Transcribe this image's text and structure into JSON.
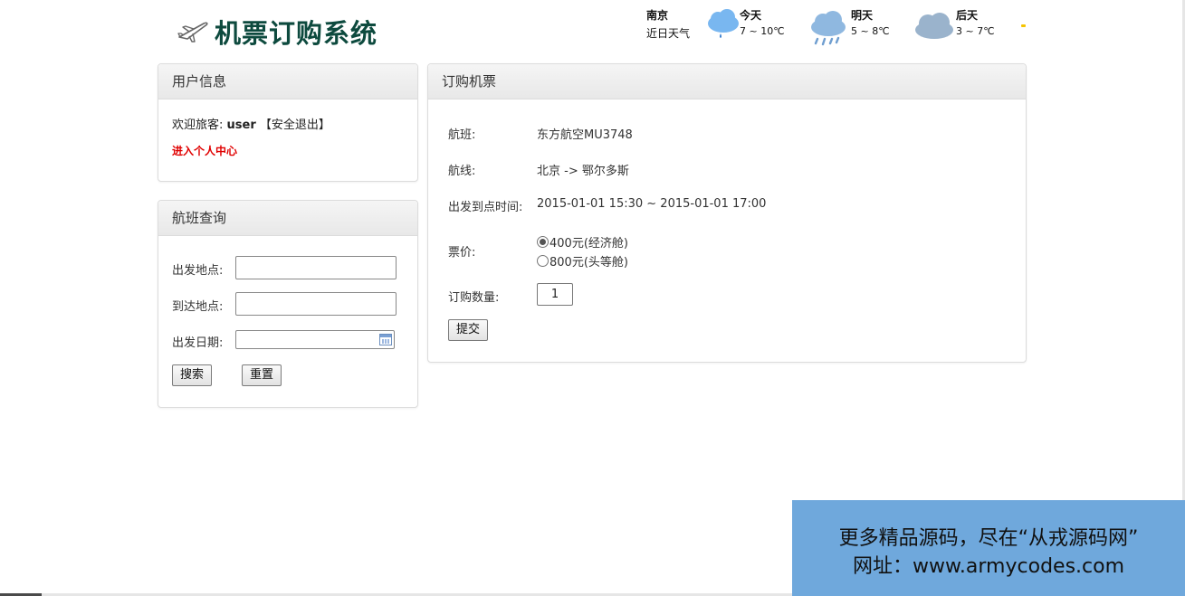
{
  "header": {
    "title": "机票订购系统",
    "logo_icon": "airplane-icon"
  },
  "weather": {
    "city": "南京",
    "subtitle": "近日天气",
    "days": [
      {
        "name": "今天",
        "temp": "7 ~ 10℃",
        "icon": "light-rain-icon",
        "color": "#79b7f0"
      },
      {
        "name": "明天",
        "temp": "5 ~ 8℃",
        "icon": "rain-icon",
        "color": "#8fb8e0"
      },
      {
        "name": "后天",
        "temp": "3 ~ 7℃",
        "icon": "cloudy-icon",
        "color": "#9ab3cc"
      }
    ]
  },
  "user_panel": {
    "title": "用户信息",
    "welcome_prefix": "欢迎旅客:",
    "username": "user",
    "logout_label": "【安全退出】",
    "center_link": "进入个人中心",
    "link_color": "#e00000"
  },
  "search_panel": {
    "title": "航班查询",
    "depart_label": "出发地点:",
    "depart_value": "",
    "arrive_label": "到达地点:",
    "arrive_value": "",
    "date_label": "出发日期:",
    "date_value": "",
    "search_button": "搜索",
    "reset_button": "重置"
  },
  "order_panel": {
    "title": "订购机票",
    "flight_label": "航班:",
    "flight_value": "东方航空MU3748",
    "route_label": "航线:",
    "route_value": "北京 -> 鄂尔多斯",
    "time_label": "出发到点时间:",
    "time_value": "2015-01-01 15:30 ~ 2015-01-01 17:00",
    "price_label": "票价:",
    "price_options": [
      {
        "label": "400元(经济舱)",
        "checked": true
      },
      {
        "label": "800元(头等舱)",
        "checked": false
      }
    ],
    "qty_label": "订购数量:",
    "qty_value": "1",
    "submit_button": "提交"
  },
  "banner": {
    "line1": "更多精品源码，尽在“从戎源码网”",
    "line2": "网址：www.armycodes.com",
    "color": "#6fa8dc"
  }
}
